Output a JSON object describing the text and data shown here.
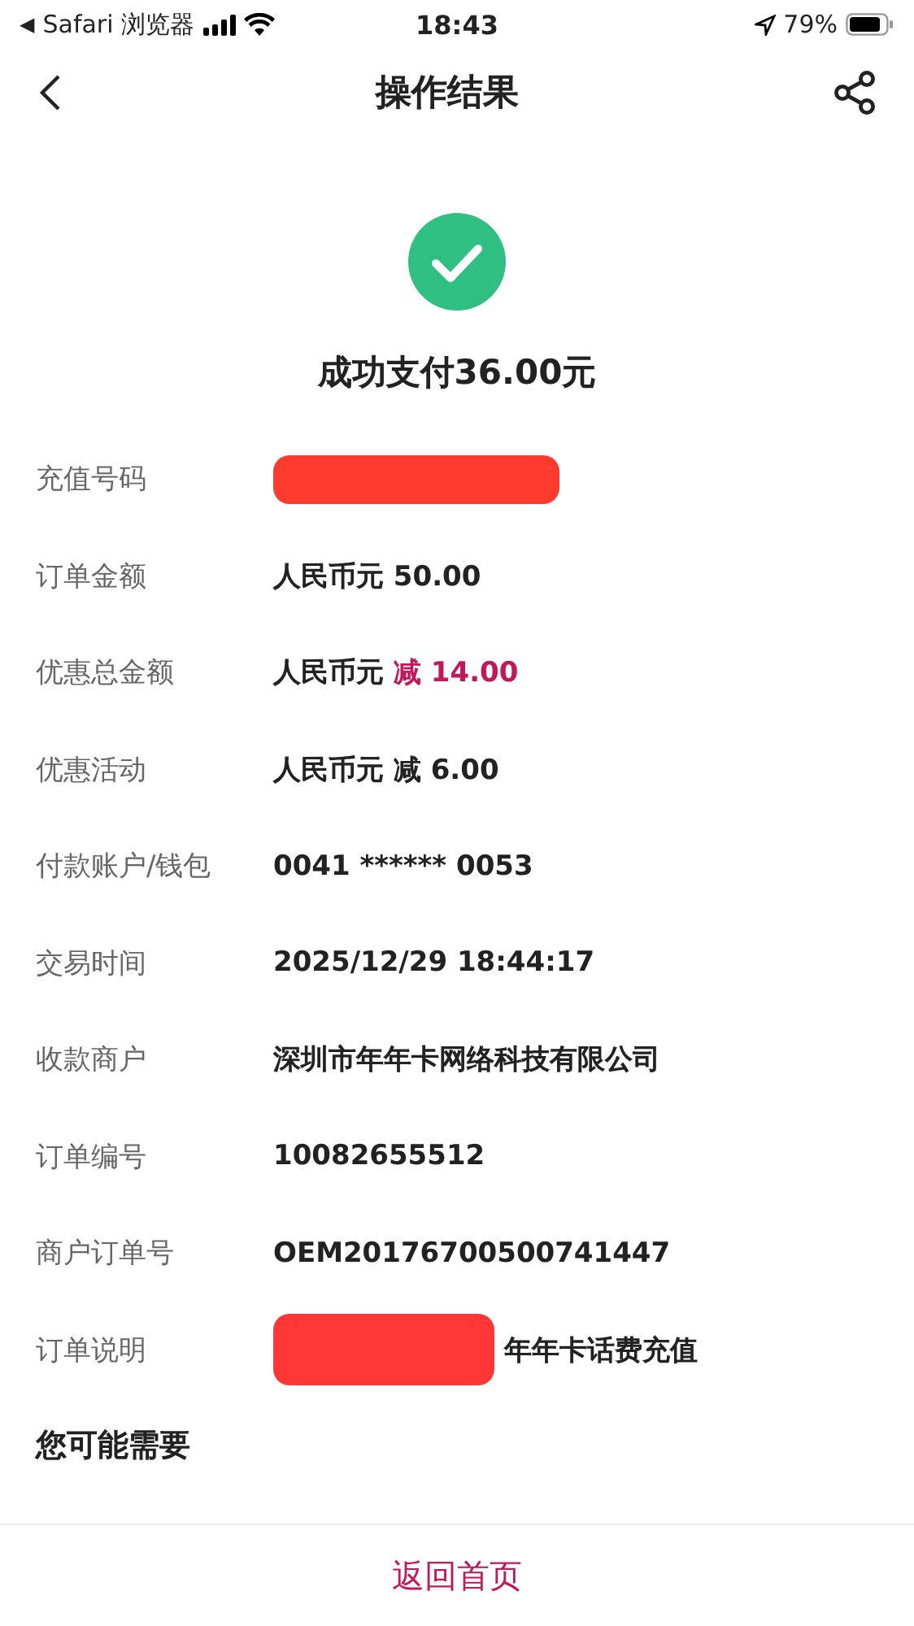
{
  "status_bar": {
    "back_arrow": "◀",
    "back_app": "Safari 浏览器",
    "time": "18:43",
    "battery": "79%"
  },
  "nav": {
    "title": "操作结果"
  },
  "result": {
    "message": "成功支付36.00元"
  },
  "details": [
    {
      "label": "充值号码",
      "kind": "redacted"
    },
    {
      "label": "订单金额",
      "kind": "plain",
      "value": "人民币元 50.00"
    },
    {
      "label": "优惠总金额",
      "kind": "discount",
      "value": "人民币元",
      "highlight": "减 14.00"
    },
    {
      "label": "优惠活动",
      "kind": "plain",
      "value": "人民币元 减 6.00"
    },
    {
      "label": "付款账户/钱包",
      "kind": "plain",
      "value": "0041 ****** 0053"
    },
    {
      "label": "交易时间",
      "kind": "plain",
      "value": "2025/12/29 18:44:17"
    },
    {
      "label": "收款商户",
      "kind": "plain",
      "value": "深圳市年年卡网络科技有限公司"
    },
    {
      "label": "订单编号",
      "kind": "plain",
      "value": "10082655512"
    },
    {
      "label": "商户订单号",
      "kind": "plain",
      "value": "OEM20176700500741447"
    },
    {
      "label": "订单说明",
      "kind": "partly_redacted",
      "value": "年年卡话费充值"
    }
  ],
  "section_title": "您可能需要",
  "footer_button": "返回首页"
}
